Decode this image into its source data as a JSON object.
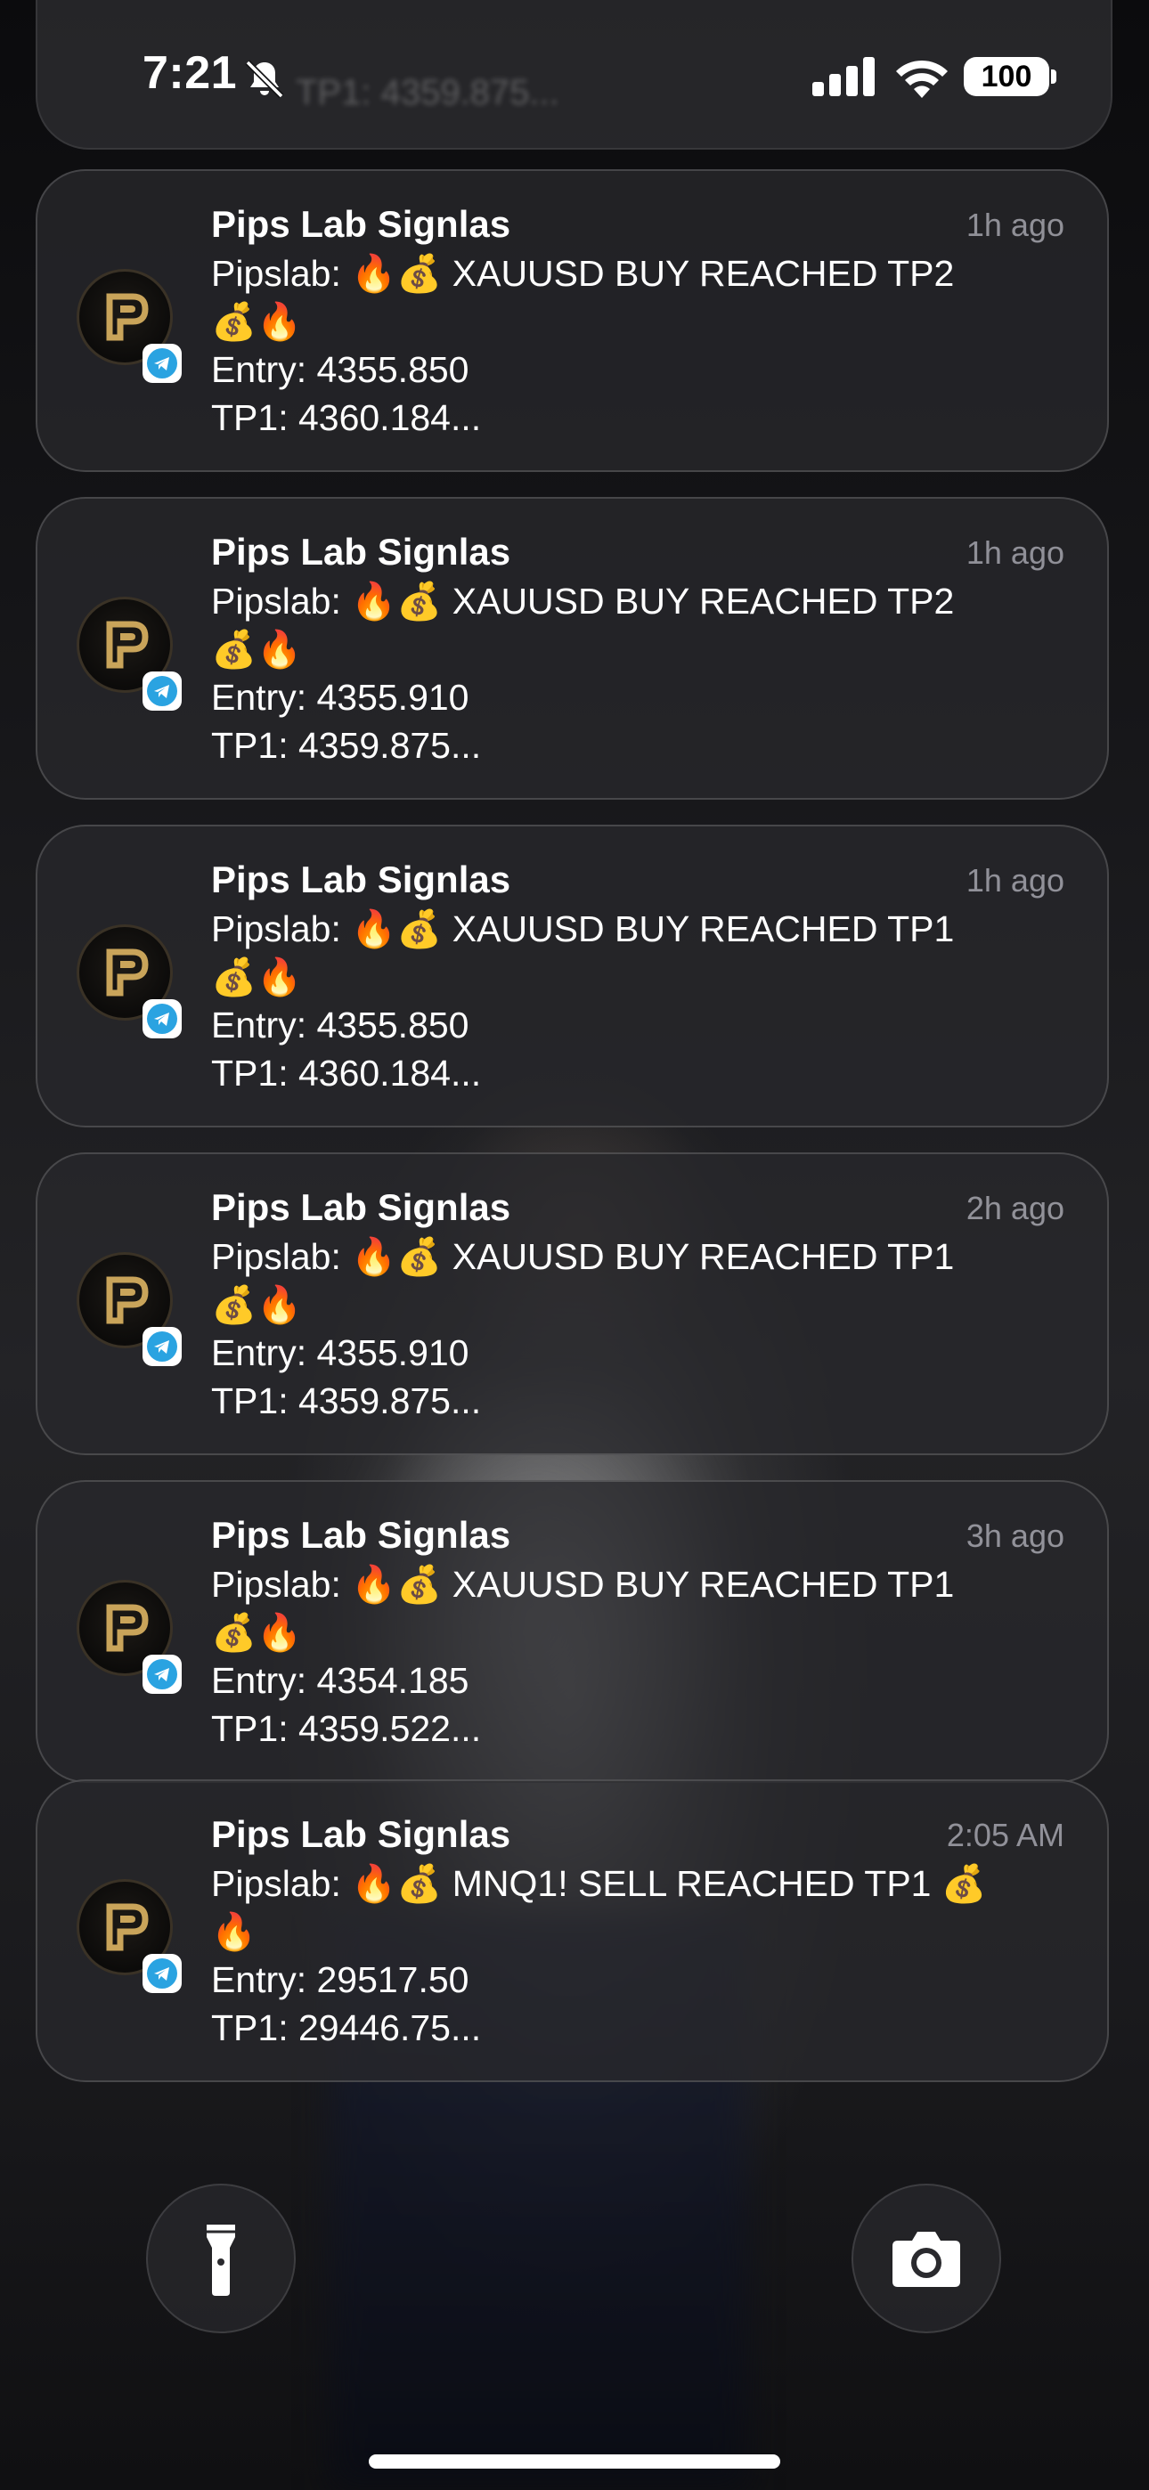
{
  "status_bar": {
    "time": "7:21",
    "battery": "100",
    "icons": [
      "bell-off-icon",
      "cellular-signal-icon",
      "wifi-icon",
      "battery-icon"
    ]
  },
  "ghost_card": {
    "text": "TP1: 4359.875..."
  },
  "notifications": [
    {
      "app": "Pips Lab Signlas",
      "time": "1h ago",
      "line1": "Pipslab: 🔥💰 XAUUSD BUY REACHED TP2",
      "line2": "💰🔥",
      "line3": "Entry: 4355.850",
      "line4": "TP1: 4360.184..."
    },
    {
      "app": "Pips Lab Signlas",
      "time": "1h ago",
      "line1": "Pipslab: 🔥💰 XAUUSD BUY REACHED TP2",
      "line2": "💰🔥",
      "line3": "Entry: 4355.910",
      "line4": "TP1: 4359.875..."
    },
    {
      "app": "Pips Lab Signlas",
      "time": "1h ago",
      "line1": "Pipslab: 🔥💰 XAUUSD BUY REACHED TP1",
      "line2": "💰🔥",
      "line3": "Entry: 4355.850",
      "line4": "TP1: 4360.184..."
    },
    {
      "app": "Pips Lab Signlas",
      "time": "2h ago",
      "line1": "Pipslab: 🔥💰 XAUUSD BUY REACHED TP1",
      "line2": "💰🔥",
      "line3": "Entry: 4355.910",
      "line4": "TP1: 4359.875..."
    },
    {
      "app": "Pips Lab Signlas",
      "time": "3h ago",
      "line1": "Pipslab: 🔥💰 XAUUSD BUY REACHED TP1",
      "line2": "💰🔥",
      "line3": "Entry: 4354.185",
      "line4": "TP1: 4359.522..."
    },
    {
      "app": "Pips Lab Signlas",
      "time": "2:05 AM",
      "line1": "Pipslab: 🔥💰 MNQ1! SELL REACHED TP1 💰",
      "line2": "🔥",
      "line3": "Entry: 29517.50",
      "line4": "TP1: 29446.75..."
    }
  ],
  "controls": {
    "flashlight": "flashlight-icon",
    "camera": "camera-icon"
  },
  "colors": {
    "telegram": "#2aa3e1",
    "logo_gold": "#c9a45a"
  }
}
